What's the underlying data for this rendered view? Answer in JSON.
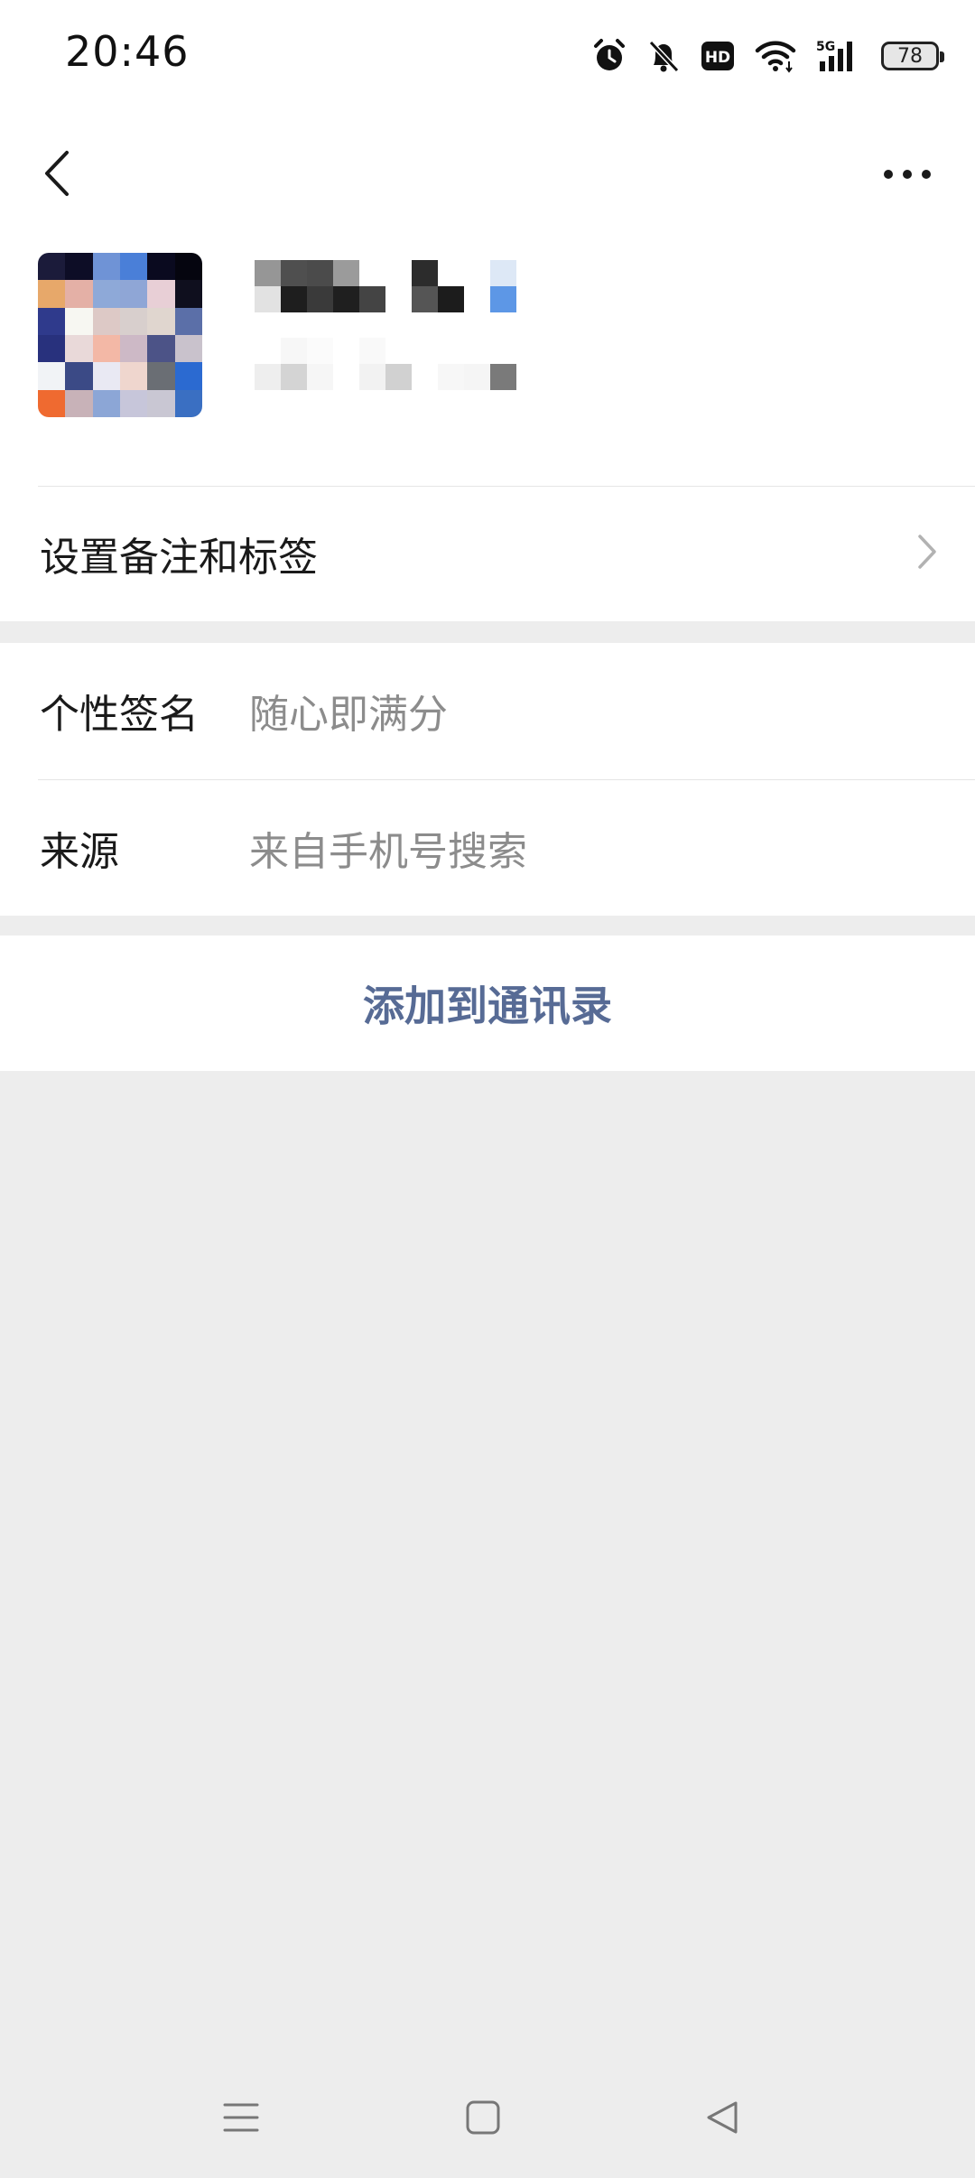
{
  "status_bar": {
    "time": "20:46",
    "icons": [
      "alarm-icon",
      "mute-bell-icon",
      "hd-icon",
      "wifi-icon",
      "5g-signal-icon",
      "battery-icon"
    ],
    "hd_label": "HD",
    "network_label": "5G",
    "battery_level": "78"
  },
  "header": {
    "back_icon": "chevron-left-icon",
    "more_icon": "more-horizontal-icon"
  },
  "profile": {
    "avatar_icon": "avatar-pixelated",
    "nickname_icon": "pixelated-nickname",
    "subtitle_icon": "pixelated-id"
  },
  "remark_row": {
    "label": "设置备注和标签"
  },
  "info": {
    "signature_key": "个性签名",
    "signature_value": "随心即满分",
    "source_key": "来源",
    "source_value": "来自手机号搜索"
  },
  "actions": {
    "add_contact_label": "添加到通讯录"
  },
  "colors": {
    "link": "#576b95",
    "background": "#ededed",
    "card": "#ffffff"
  },
  "nav_bar": {
    "icons": [
      "menu-icon",
      "home-square-icon",
      "back-triangle-icon"
    ]
  }
}
